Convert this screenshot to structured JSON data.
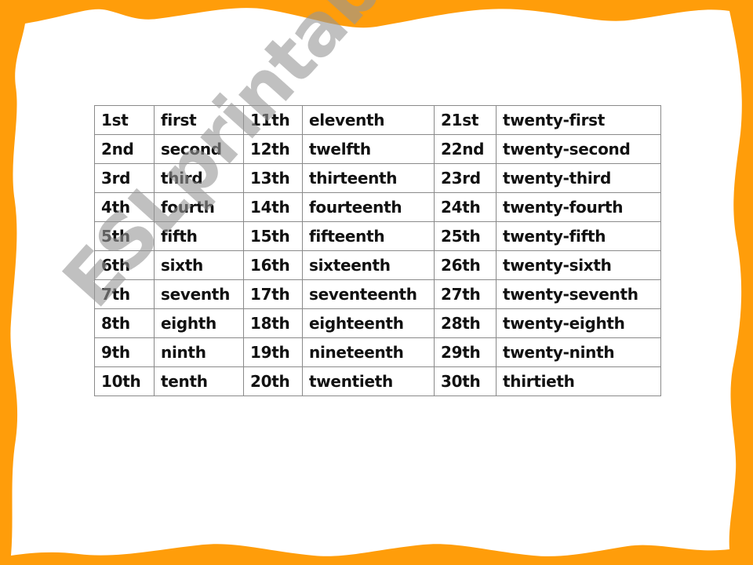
{
  "colors": {
    "frame": "#ff9d0a",
    "background": "#ffffff",
    "table_border": "#8a8a8a",
    "watermark": "#969696"
  },
  "watermark": "ESLprintables.com",
  "table": {
    "rows": [
      [
        "1st",
        "first",
        "11th",
        "eleventh",
        "21st",
        "twenty-first"
      ],
      [
        "2nd",
        "second",
        "12th",
        "twelfth",
        "22nd",
        "twenty-second"
      ],
      [
        "3rd",
        "third",
        "13th",
        "thirteenth",
        "23rd",
        "twenty-third"
      ],
      [
        "4th",
        "fourth",
        "14th",
        "fourteenth",
        "24th",
        "twenty-fourth"
      ],
      [
        "5th",
        "fifth",
        "15th",
        "fifteenth",
        "25th",
        "twenty-fifth"
      ],
      [
        "6th",
        "sixth",
        "16th",
        "sixteenth",
        "26th",
        "twenty-sixth"
      ],
      [
        "7th",
        "seventh",
        "17th",
        "seventeenth",
        "27th",
        "twenty-seventh"
      ],
      [
        "8th",
        "eighth",
        "18th",
        "eighteenth",
        "28th",
        "twenty-eighth"
      ],
      [
        "9th",
        "ninth",
        "19th",
        "nineteenth",
        "29th",
        "twenty-ninth"
      ],
      [
        "10th",
        "tenth",
        "20th",
        "twentieth",
        "30th",
        "thirtieth"
      ]
    ]
  }
}
